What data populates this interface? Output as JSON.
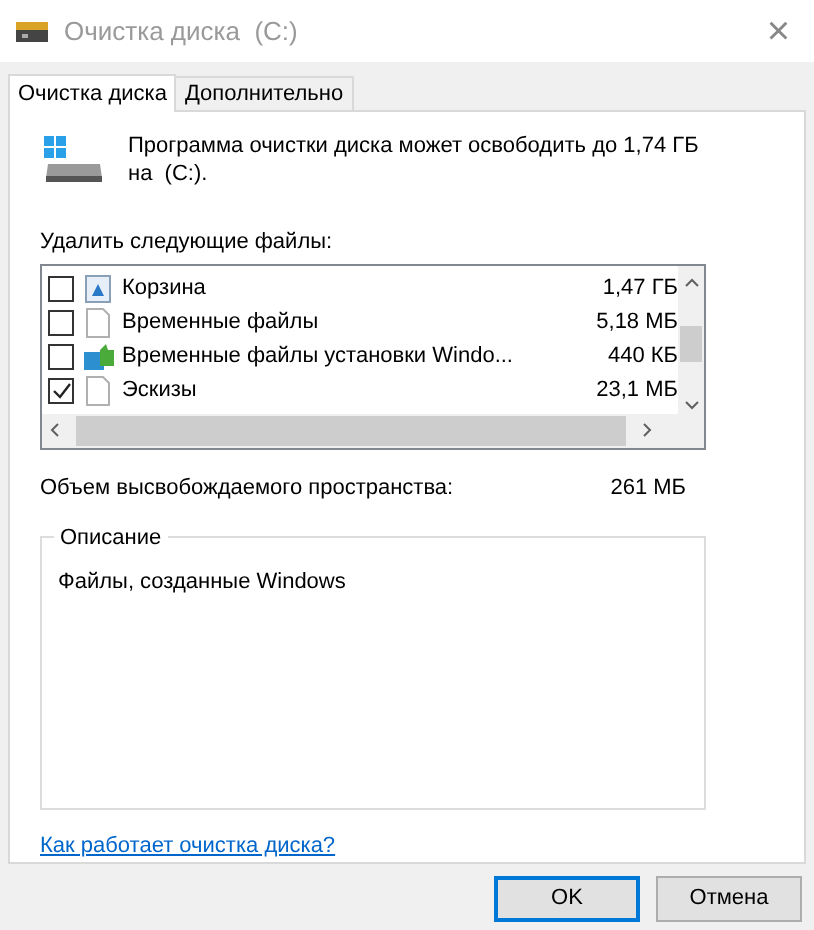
{
  "window": {
    "title": "Очистка диска  (C:)",
    "close": "×"
  },
  "tabs": [
    {
      "label": "Очистка диска",
      "selected": true
    },
    {
      "label": "Дополнительно",
      "selected": false
    }
  ],
  "summary": "Программа очистки диска может освободить до 1,74 ГБ на  (C:).",
  "files_label": "Удалить следующие файлы:",
  "files": [
    {
      "kind": "recycle",
      "name": "Корзина",
      "size": "1,47 ГБ",
      "checked": false
    },
    {
      "kind": "file",
      "name": "Временные файлы",
      "size": "5,18 МБ",
      "checked": false
    },
    {
      "kind": "setup",
      "name": "Временные файлы установки Windo...",
      "size": "440 КБ",
      "checked": false
    },
    {
      "kind": "file",
      "name": "Эскизы",
      "size": "23,1 МБ",
      "checked": true
    }
  ],
  "space": {
    "label": "Объем высвобождаемого пространства:",
    "value": "261 МБ"
  },
  "description": {
    "legend": "Описание",
    "text": "Файлы, созданные Windows"
  },
  "help_link": "Как работает очистка диска?",
  "buttons": [
    {
      "label": "OK",
      "default": true
    },
    {
      "label": "Отмена",
      "default": false
    }
  ]
}
